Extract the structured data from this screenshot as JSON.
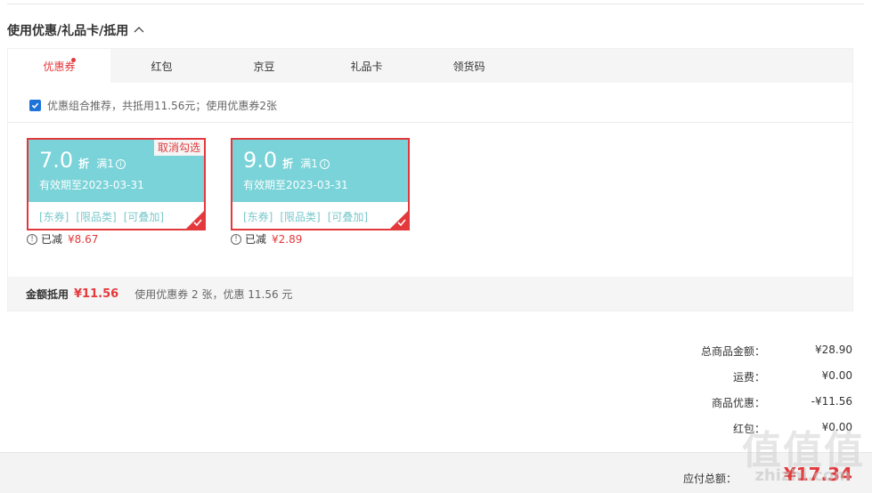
{
  "section": {
    "title": "使用优惠/礼品卡/抵用"
  },
  "tabs": [
    {
      "label": "优惠券",
      "active": true,
      "has_dot": true
    },
    {
      "label": "红包"
    },
    {
      "label": "京豆"
    },
    {
      "label": "礼品卡"
    },
    {
      "label": "领货码"
    }
  ],
  "recommend": {
    "text": "优惠组合推荐，共抵用11.56元；使用优惠券2张",
    "checked": true
  },
  "coupons": [
    {
      "value": "7.0",
      "unit": "折",
      "condition": "满1",
      "expiry": "有效期至2023-03-31",
      "tags": [
        "[东券]",
        "[限品类]",
        "[可叠加]"
      ],
      "cancel_label": "取消勾选",
      "saved_label": "已减",
      "saved_amount": "¥8.67"
    },
    {
      "value": "9.0",
      "unit": "折",
      "condition": "满1",
      "expiry": "有效期至2023-03-31",
      "tags": [
        "[东券]",
        "[限品类]",
        "[可叠加]"
      ],
      "saved_label": "已减",
      "saved_amount": "¥2.89"
    }
  ],
  "summary": {
    "label": "金额抵用",
    "amount": "¥11.56",
    "desc": "使用优惠券 2 张，优惠 11.56 元"
  },
  "prices": [
    {
      "label": "总商品金额：",
      "value": "¥28.90"
    },
    {
      "label": "运费：",
      "value": "¥0.00"
    },
    {
      "label": "商品优惠：",
      "value": "-¥11.56"
    },
    {
      "label": "红包：",
      "value": "¥0.00"
    }
  ],
  "payable": {
    "label": "应付总额：",
    "value": "¥17.34"
  },
  "watermark": {
    "glyphs": "值值值",
    "site": "zhizhi.com"
  },
  "colors": {
    "accent": "#e4393c",
    "coupon": "#79d3d8",
    "checkbox": "#1e73d8"
  }
}
